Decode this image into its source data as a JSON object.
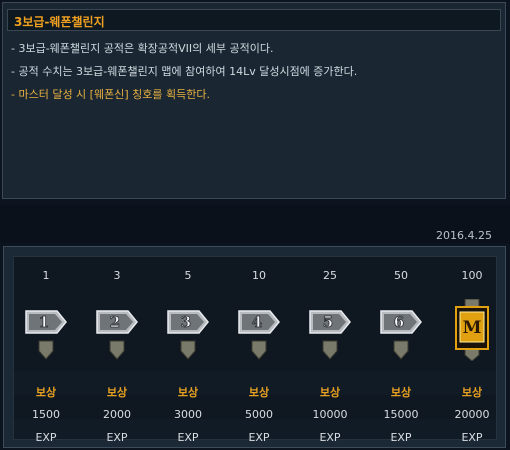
{
  "panel": {
    "title": "3보급-웨폰챌린지",
    "lines": [
      "- 3보급-웨폰챌린지 공적은 확장공적VII의 세부 공적이다.",
      "- 공적 수치는 3보급-웨폰챌린지 맵에 참여하여 14Lv 달성시점에 증가한다.",
      "- 마스터 달성 시 [웨폰신] 칭호를 획득한다."
    ]
  },
  "date": "2016.4.25",
  "rewards": {
    "tiers": [
      {
        "level": "1",
        "badge": "1",
        "reward": "보상",
        "exp": "1500",
        "unit": "EXP"
      },
      {
        "level": "3",
        "badge": "2",
        "reward": "보상",
        "exp": "2000",
        "unit": "EXP"
      },
      {
        "level": "5",
        "badge": "3",
        "reward": "보상",
        "exp": "3000",
        "unit": "EXP"
      },
      {
        "level": "10",
        "badge": "4",
        "reward": "보상",
        "exp": "5000",
        "unit": "EXP"
      },
      {
        "level": "25",
        "badge": "5",
        "reward": "보상",
        "exp": "10000",
        "unit": "EXP"
      },
      {
        "level": "50",
        "badge": "6",
        "reward": "보상",
        "exp": "15000",
        "unit": "EXP"
      },
      {
        "level": "100",
        "badge": "M",
        "reward": "보상",
        "exp": "20000",
        "unit": "EXP"
      }
    ]
  },
  "colors": {
    "title": "#f0a020",
    "reward_label": "#e8a020",
    "badge_silver": "#b8bcc0",
    "badge_gold": "#e0a010"
  }
}
